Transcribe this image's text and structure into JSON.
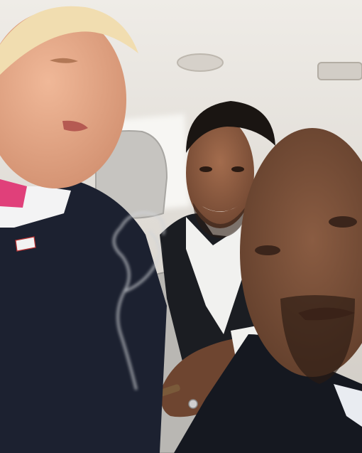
{
  "image": {
    "kind": "photograph",
    "scene": "car-interior-selfie",
    "colors": {
      "headliner": "#e2ddd6",
      "window": "#f4f2ee",
      "seat": "#bcbab6",
      "suit_dark": "#1c2130",
      "skin_light": "#e7a98a",
      "skin_dark": "#8a5a40",
      "tie_pink": "#e0407a",
      "smoke": "#c9cbd0"
    }
  }
}
